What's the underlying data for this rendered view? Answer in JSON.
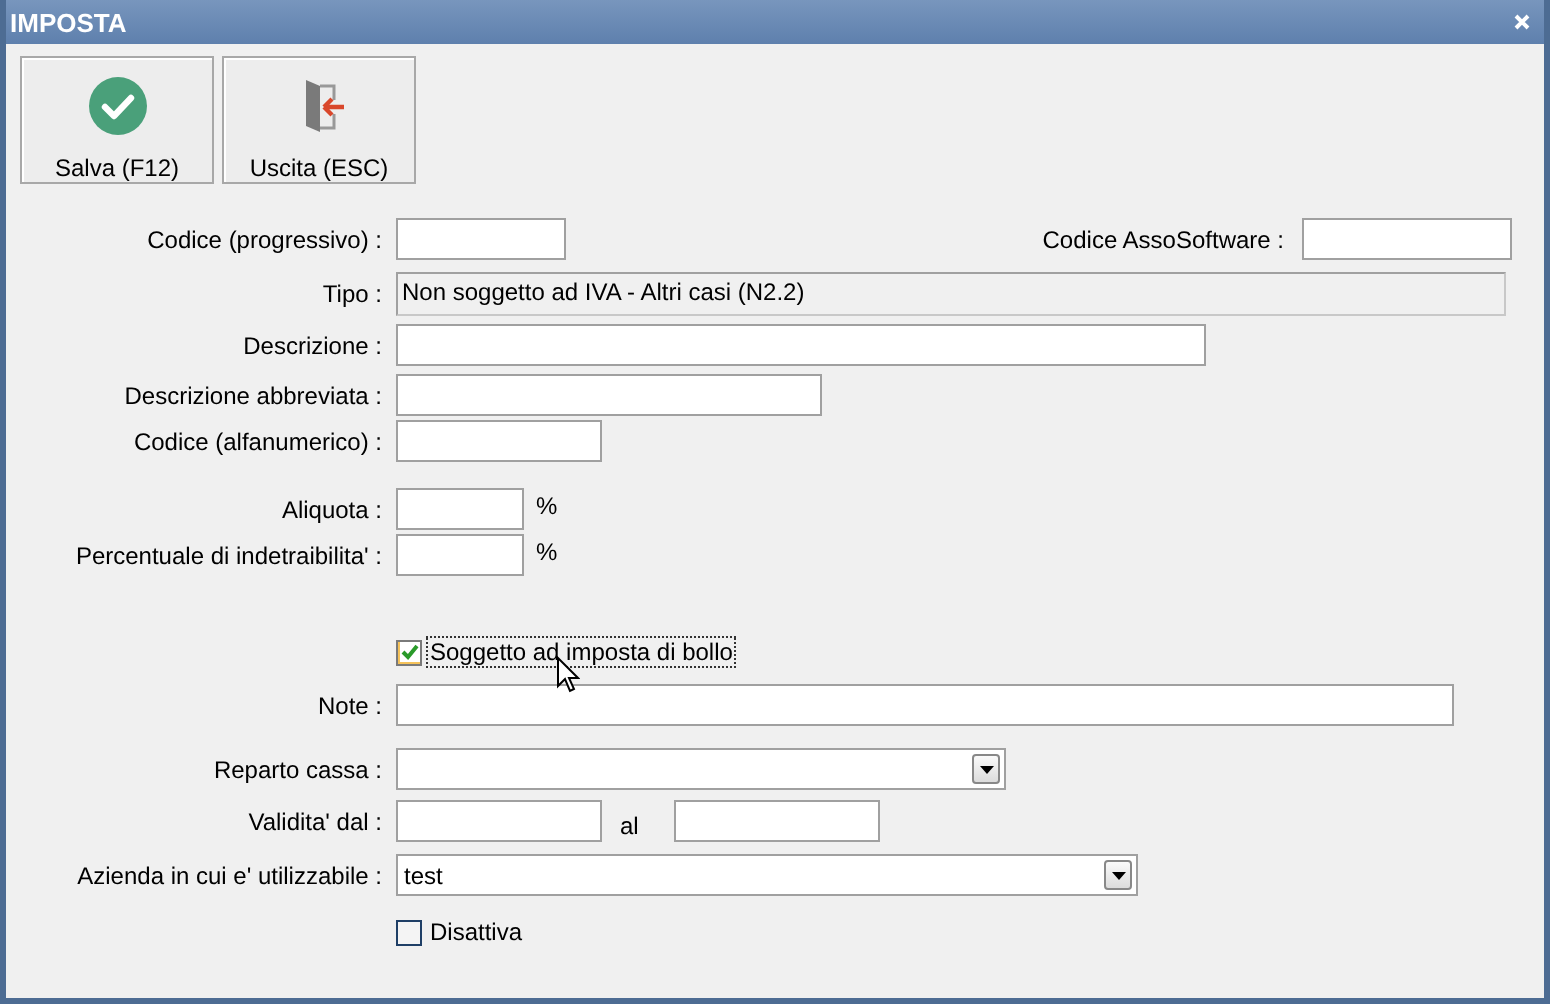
{
  "window": {
    "title": "IMPOSTA"
  },
  "toolbar": [
    {
      "label": "Salva (F12)",
      "kind": "save"
    },
    {
      "label": "Uscita (ESC)",
      "kind": "exit"
    }
  ],
  "codice": {
    "label": "Codice (progressivo) :"
  },
  "asso": {
    "label": "Codice AssoSoftware :"
  },
  "tipo": {
    "label": "Tipo :",
    "value": "Non soggetto ad IVA - Altri casi (N2.2)"
  },
  "descrizione": {
    "label": "Descrizione :"
  },
  "abbreviata": {
    "label": "Descrizione abbreviata :"
  },
  "alfanumerico": {
    "label": "Codice (alfanumerico) :"
  },
  "aliquota": {
    "label": "Aliquota :",
    "unit": "%"
  },
  "indetraibilita": {
    "label": "Percentuale di indetraibilita' :",
    "unit": "%"
  },
  "bollo": {
    "label": "Soggetto ad imposta di bollo",
    "checked": true,
    "focused": true
  },
  "note": {
    "label": "Note :"
  },
  "reparto": {
    "label": "Reparto cassa :"
  },
  "validita": {
    "label": "Validita' dal :",
    "to_label": "al"
  },
  "azienda": {
    "label": "Azienda in cui e' utilizzabile :",
    "value": "test"
  },
  "disattiva": {
    "label": "Disattiva",
    "checked": false,
    "focused": false
  }
}
